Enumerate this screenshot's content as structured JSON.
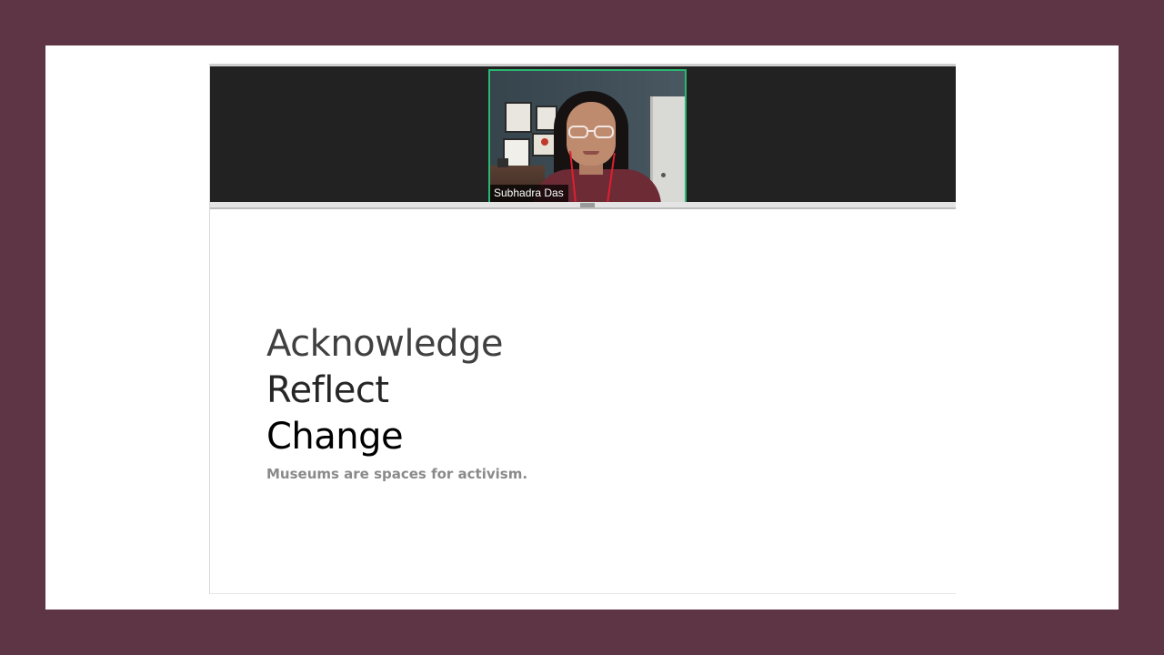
{
  "colors": {
    "outer_background": "#5e3544",
    "frame_background": "#ffffff",
    "video_strip": "#222222",
    "active_speaker_border": "#2bb673"
  },
  "video": {
    "participant_name": "Subhadra Das"
  },
  "slide": {
    "lines": [
      "Acknowledge",
      "Reflect",
      "Change"
    ],
    "subtitle": "Museums are spaces for activism."
  }
}
